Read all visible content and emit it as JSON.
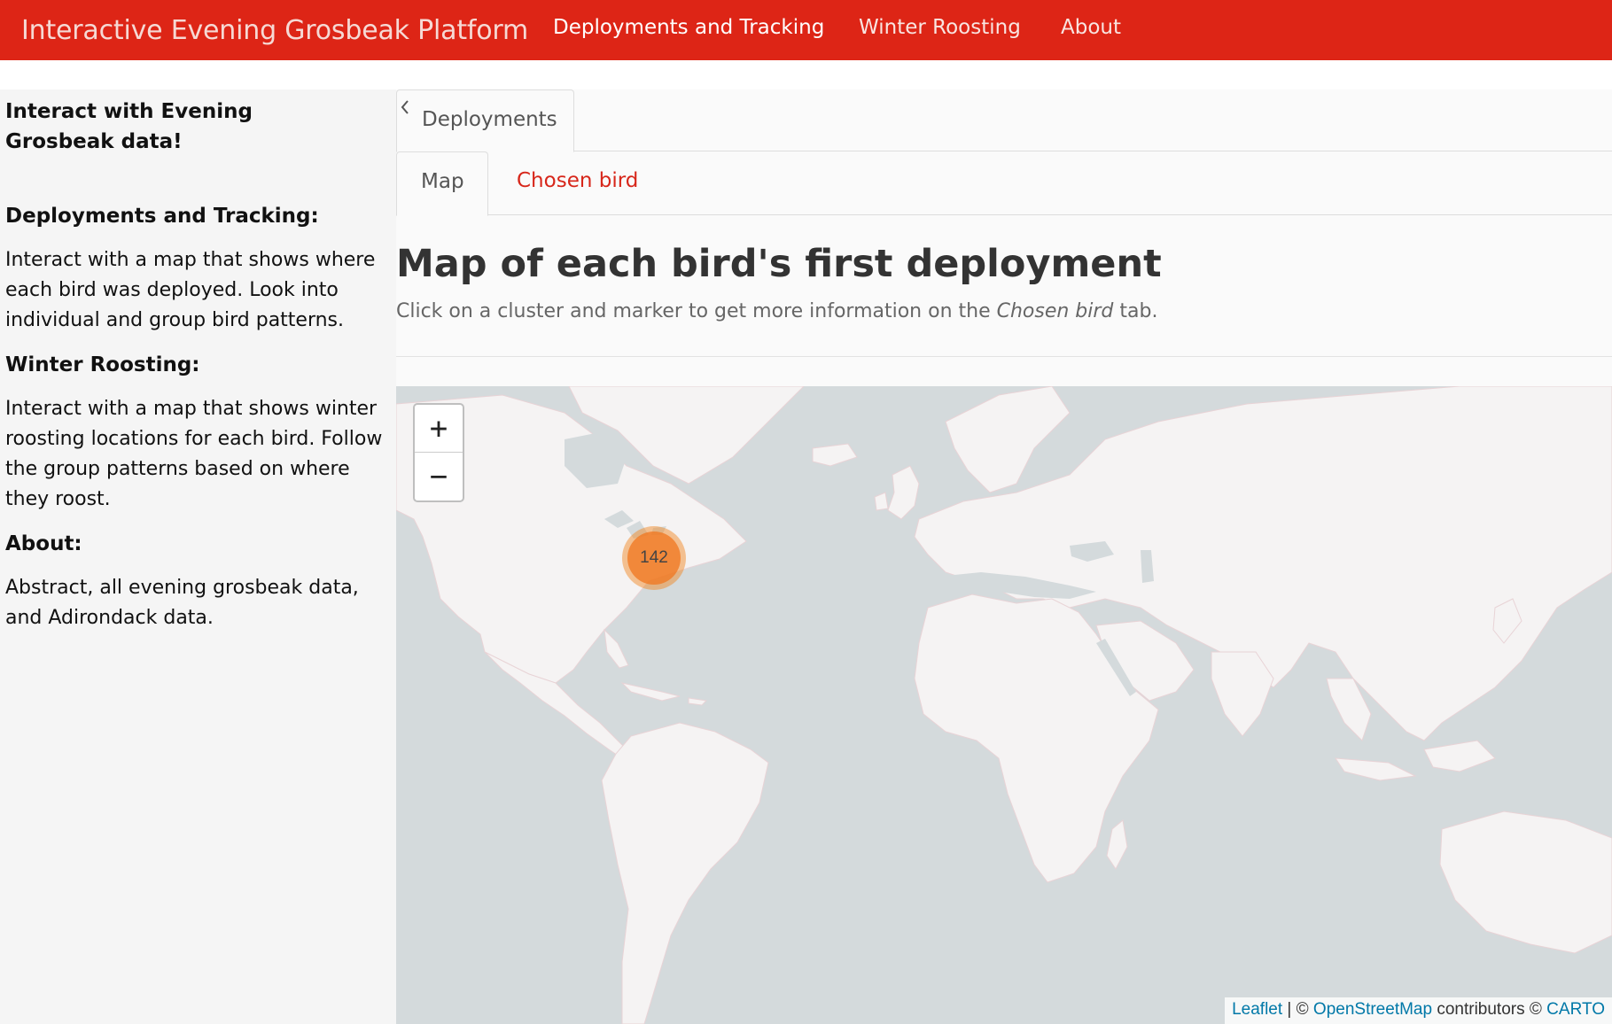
{
  "navbar": {
    "brand": "Interactive Evening Grosbeak Platform",
    "links": [
      "Deployments and Tracking",
      "Winter Roosting",
      "About"
    ],
    "active": "Deployments and Tracking",
    "color": "#dd2516"
  },
  "sidebar": {
    "intro": "Interact with Evening Grosbeak data!",
    "sections": [
      {
        "heading": "Deployments and Tracking:",
        "text": "Interact with a map that shows where each bird was deployed. Look into individual and group bird patterns."
      },
      {
        "heading": "Winter Roosting:",
        "text": "Interact with a map that shows winter roosting locations for each bird. Follow the group patterns based on where they roost."
      },
      {
        "heading": "About:",
        "text": "Abstract, all evening grosbeak data, and Adirondack data."
      }
    ],
    "collapse_icon": "chevron-left-icon"
  },
  "tabs": {
    "outer": [
      "Deployments"
    ],
    "inner": [
      "Map",
      "Chosen bird"
    ],
    "active_inner": "Map",
    "accent": "#d7261a"
  },
  "main": {
    "title": "Map of each bird's first deployment",
    "subtitle_before": "Click on a cluster and marker to get more information on the ",
    "subtitle_em": "Chosen bird",
    "subtitle_after": " tab."
  },
  "map": {
    "zoom_in": "+",
    "zoom_out": "−",
    "cluster_count": "142",
    "cluster_color": "#f0751e",
    "attribution": {
      "leaflet": "Leaflet",
      "sep": " | © ",
      "osm": "OpenStreetMap",
      "contributors": " contributors © ",
      "carto": "CARTO"
    }
  }
}
